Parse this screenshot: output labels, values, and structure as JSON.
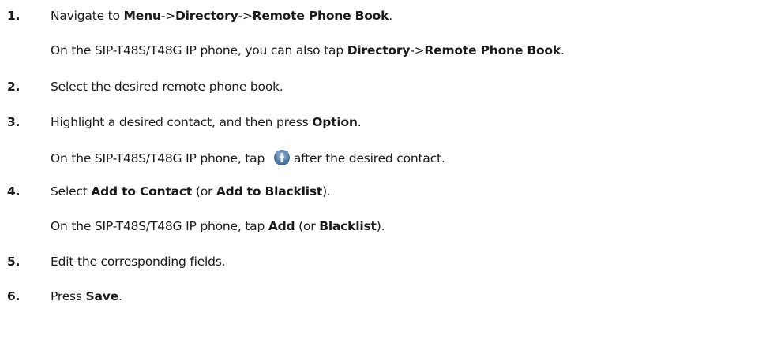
{
  "steps": [
    {
      "number": "1.",
      "parts": [
        "Navigate to ",
        "Menu",
        "->",
        "Directory",
        "->",
        "Remote Phone Book",
        "."
      ],
      "note": [
        "On the SIP-T48S/T48G IP phone, you can also tap ",
        "Directory",
        "->",
        "Remote Phone Book",
        "."
      ]
    },
    {
      "number": "2.",
      "text": "Select the desired remote phone book."
    },
    {
      "number": "3.",
      "parts": [
        "Highlight a desired contact, and then press ",
        "Option",
        "."
      ],
      "note": [
        "On the SIP-T48S/T48G IP phone, tap ",
        "after the desired contact."
      ],
      "note_icon": "contact-option-icon"
    },
    {
      "number": "4.",
      "parts": [
        "Select ",
        "Add to Contact",
        " (or ",
        "Add to Blacklist",
        ")."
      ],
      "note": [
        "On the SIP-T48S/T48G IP phone, tap ",
        "Add",
        " (or ",
        "Blacklist",
        ")."
      ]
    },
    {
      "number": "5.",
      "text": "Edit the corresponding fields."
    },
    {
      "number": "6.",
      "parts": [
        "Press ",
        "Save",
        "."
      ]
    }
  ]
}
